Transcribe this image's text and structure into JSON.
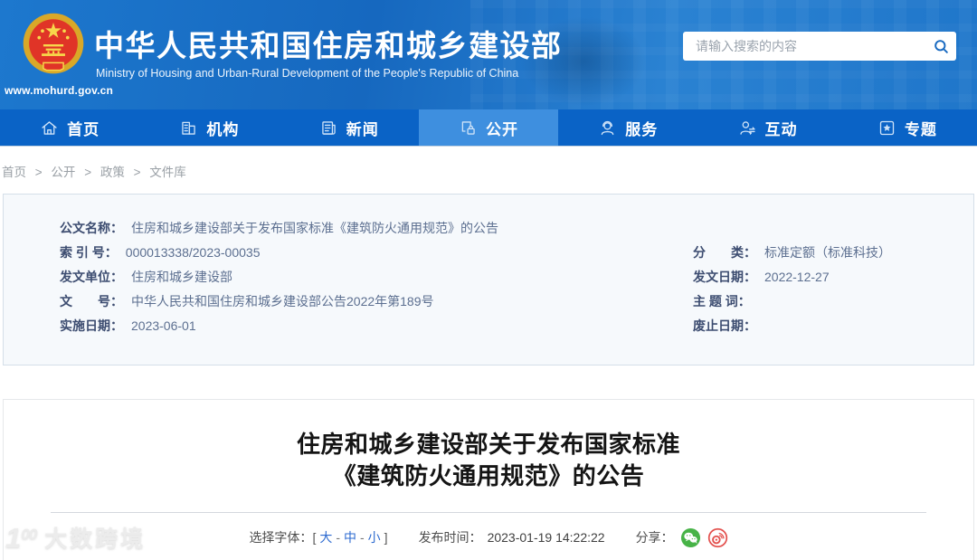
{
  "colors": {
    "header_blue": "#1d78ce",
    "nav_blue": "#0a63c6",
    "active_tab_blue": "#3e8fdf",
    "link_blue": "#2e6bd0",
    "meta_label_navy": "#3c4c70",
    "meta_value_slate": "#5c6f90",
    "wechat_green": "#47b347",
    "weibo_red": "#e3504d"
  },
  "header": {
    "site_url": "www.mohurd.gov.cn",
    "title_cn": "中华人民共和国住房和城乡建设部",
    "title_en": "Ministry of Housing and Urban-Rural Development of the People's Republic of China",
    "search_placeholder": "请输入搜索的内容"
  },
  "nav": {
    "items": [
      {
        "label": "首页",
        "icon": "home-icon",
        "active": false
      },
      {
        "label": "机构",
        "icon": "organization-icon",
        "active": false
      },
      {
        "label": "新闻",
        "icon": "news-icon",
        "active": false
      },
      {
        "label": "公开",
        "icon": "disclosure-icon",
        "active": true
      },
      {
        "label": "服务",
        "icon": "service-icon",
        "active": false
      },
      {
        "label": "互动",
        "icon": "interaction-icon",
        "active": false
      },
      {
        "label": "专题",
        "icon": "topics-icon",
        "active": false
      }
    ]
  },
  "breadcrumb": {
    "separator": ">",
    "items": [
      "首页",
      "公开",
      "政策",
      "文件库"
    ]
  },
  "doc_meta": {
    "left_rows": [
      {
        "label": "公文名称：",
        "value": "住房和城乡建设部关于发布国家标准《建筑防火通用规范》的公告"
      },
      {
        "label": "索 引 号：",
        "value": "000013338/2023-00035"
      },
      {
        "label": "发文单位：",
        "value": "住房和城乡建设部"
      },
      {
        "label": "文　　号：",
        "value": "中华人民共和国住房和城乡建设部公告2022年第189号"
      },
      {
        "label": "实施日期：",
        "value": "2023-06-01"
      }
    ],
    "right_rows": [
      {
        "label": "分　　类：",
        "value": "标准定额（标准科技）"
      },
      {
        "label": "发文日期：",
        "value": "2022-12-27"
      },
      {
        "label": "主 题 词：",
        "value": ""
      },
      {
        "label": "废止日期：",
        "value": ""
      }
    ]
  },
  "article": {
    "title_line1": "住房和城乡建设部关于发布国家标准",
    "title_line2": "《建筑防火通用规范》的公告",
    "font_select": {
      "label": "选择字体：",
      "bracket_open": "[",
      "separator": "-",
      "bracket_close": "]",
      "sizes": [
        "大",
        "中",
        "小"
      ]
    },
    "publish": {
      "label": "发布时间：",
      "time": "2023-01-19 14:22:22"
    },
    "share": {
      "label": "分享：",
      "icons": [
        "wechat-icon",
        "weibo-icon"
      ]
    }
  },
  "watermark": {
    "logo_1": "1",
    "logo_00": "00",
    "text": "大数跨境"
  }
}
